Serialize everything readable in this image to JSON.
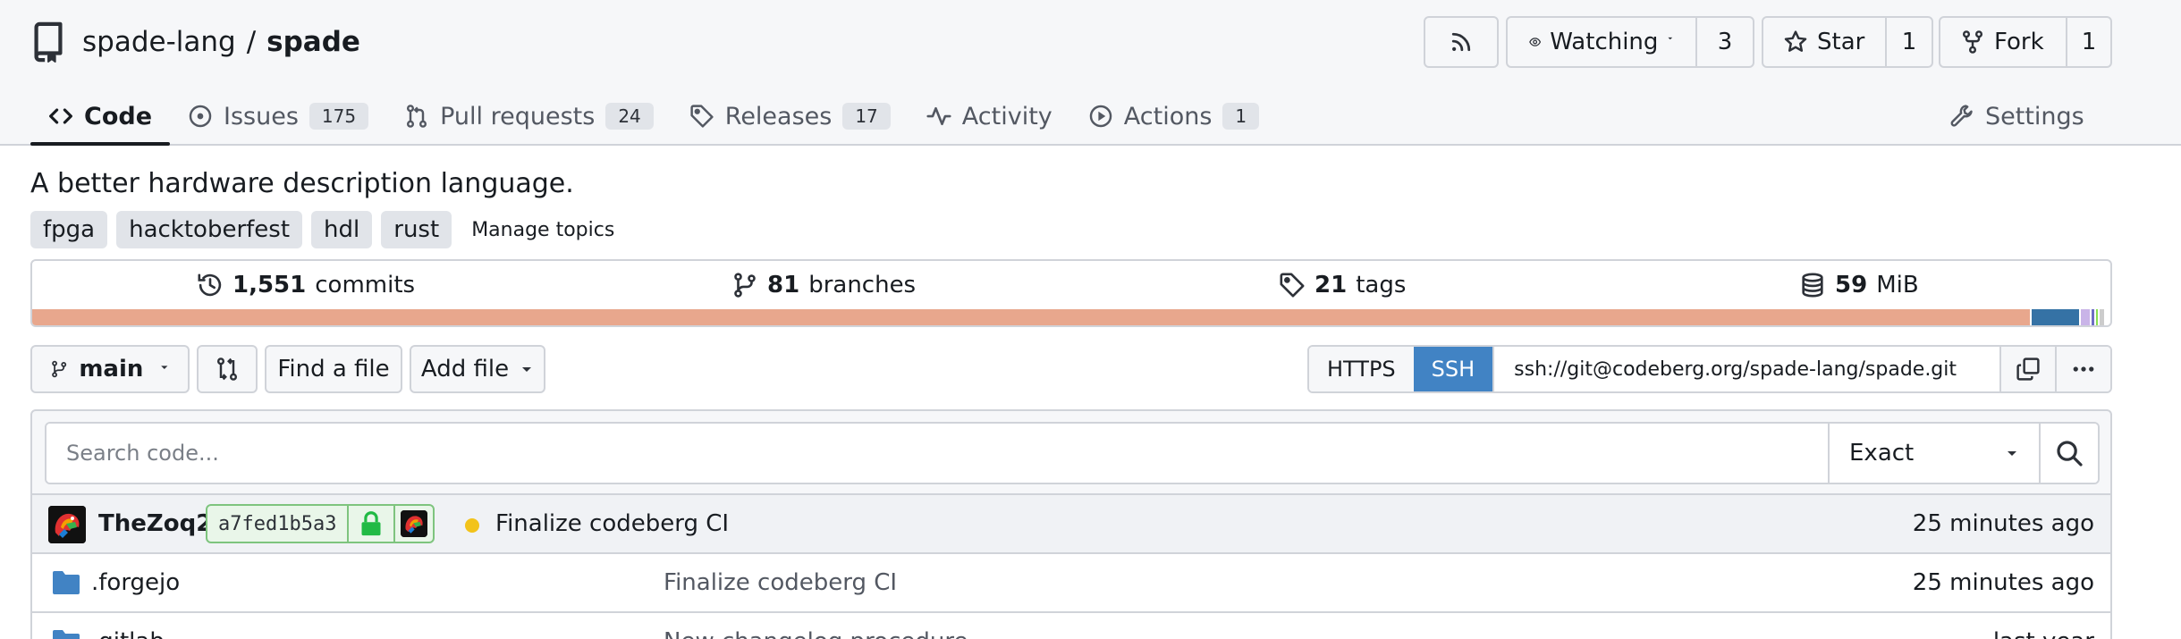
{
  "repo": {
    "owner": "spade-lang",
    "separator": "/",
    "name": "spade"
  },
  "header_actions": {
    "watch_label": "Watching",
    "watch_count": "3",
    "star_label": "Star",
    "star_count": "1",
    "fork_label": "Fork",
    "fork_count": "1"
  },
  "tabs": [
    {
      "label": "Code",
      "icon": "code-icon",
      "active": true
    },
    {
      "label": "Issues",
      "count": "175",
      "icon": "issue-icon"
    },
    {
      "label": "Pull requests",
      "count": "24",
      "icon": "pull-request-icon"
    },
    {
      "label": "Releases",
      "count": "17",
      "icon": "tag-icon"
    },
    {
      "label": "Activity",
      "icon": "pulse-icon"
    },
    {
      "label": "Actions",
      "count": "1",
      "icon": "play-icon"
    }
  ],
  "settings_label": "Settings",
  "description": "A better hardware description language.",
  "topics": [
    "fpga",
    "hacktoberfest",
    "hdl",
    "rust"
  ],
  "manage_topics_label": "Manage topics",
  "stats": {
    "commits_count": "1,551",
    "commits_label": "commits",
    "branches_count": "81",
    "branches_label": "branches",
    "tags_count": "21",
    "tags_label": "tags",
    "size_count": "59",
    "size_label": "MiB"
  },
  "language_bar": [
    {
      "share": 0.962,
      "color": "#e8a78d"
    },
    {
      "share": 0.024,
      "color": "#3572a5"
    },
    {
      "share": 0.005,
      "color": "#c9b4e8"
    },
    {
      "share": 0.002,
      "color": "#6e6ec4"
    },
    {
      "share": 0.002,
      "color": "#89e051"
    },
    {
      "share": 0.002,
      "color": "#cccccc"
    }
  ],
  "toolbar": {
    "branch_label": "main",
    "find_file_label": "Find a file",
    "add_file_label": "Add file"
  },
  "clone": {
    "https_label": "HTTPS",
    "ssh_label": "SSH",
    "url": "ssh://git@codeberg.org/spade-lang/spade.git"
  },
  "code_search": {
    "placeholder": "Search code...",
    "mode": "Exact"
  },
  "latest_commit": {
    "author": "TheZoq2",
    "sha": "a7fed1b5a3",
    "message": "Finalize codeberg CI",
    "time": "25 minutes ago"
  },
  "files": [
    {
      "name": ".forgejo",
      "message": "Finalize codeberg CI",
      "time": "25 minutes ago"
    },
    {
      "name": ".gitlab",
      "message": "New changelog procedure",
      "time": "last year"
    }
  ],
  "colors": {
    "accent_blue": "#4183c4",
    "border": "#d0d3d9",
    "header_bg": "#f6f7f9",
    "status_pending": "#f2c31b",
    "verified_green": "#21ba45"
  }
}
